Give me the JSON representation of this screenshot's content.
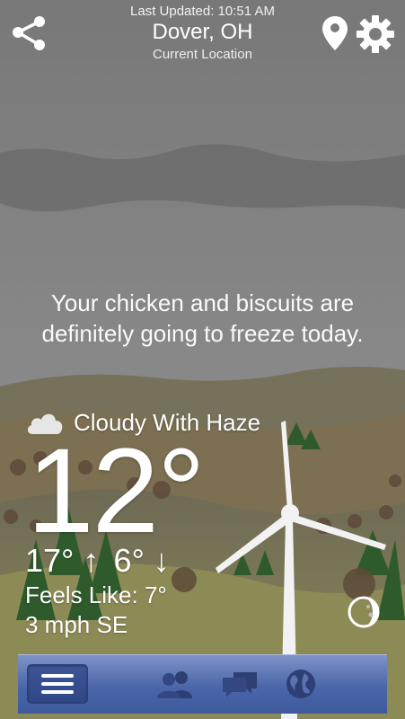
{
  "header": {
    "last_updated": "Last Updated: 10:51 AM",
    "city": "Dover, OH",
    "location_label": "Current Location"
  },
  "tagline": "Your chicken and biscuits are definitely going to freeze today.",
  "weather": {
    "condition": "Cloudy With Haze",
    "temperature": "12°",
    "high": "17° ↑",
    "low": "6° ↓",
    "feels_like_label": "Feels Like:",
    "feels_like_value": "7°",
    "wind": "3 mph SE"
  },
  "icons": {
    "share": "share-icon",
    "location": "map-pin-icon",
    "settings": "gear-icon",
    "condition": "cloud-icon",
    "moon": "moon-phase-icon",
    "menu": "menu-icon",
    "friends": "friends-icon",
    "chat": "chat-icon",
    "globe": "globe-icon"
  },
  "colors": {
    "sky": "#7b7b7b",
    "tabbar": "#4b66a8",
    "tabbar_icons": "#2d3f73"
  }
}
